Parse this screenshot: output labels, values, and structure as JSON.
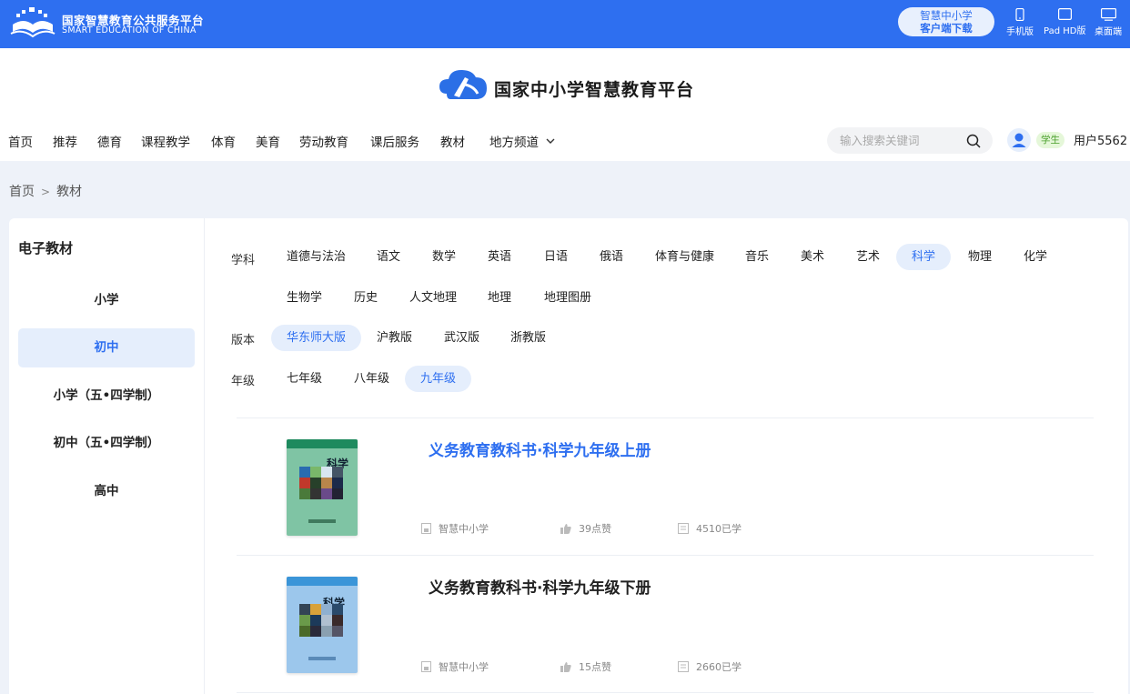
{
  "topbar": {
    "brand_cn": "国家智慧教育公共服务平台",
    "brand_en": "SMART EDUCATION OF CHINA",
    "download_line1": "智慧中小学",
    "download_line2": "客户端下载",
    "devices": [
      {
        "label": "手机版",
        "icon": "phone-icon"
      },
      {
        "label": "Pad HD版",
        "icon": "tablet-icon"
      },
      {
        "label": "桌面端",
        "icon": "desktop-icon"
      }
    ]
  },
  "header": {
    "site_title": "国家中小学智慧教育平台",
    "nav": [
      "首页",
      "推荐",
      "德育",
      "课程教学",
      "体育",
      "美育",
      "劳动教育",
      "课后服务",
      "教材",
      "地方频道"
    ],
    "search_placeholder": "输入搜索关键词",
    "role_badge": "学生",
    "username": "用户5562"
  },
  "breadcrumb": {
    "home": "首页",
    "sep": ">",
    "current": "教材"
  },
  "sidebar": {
    "title": "电子教材",
    "items": [
      "小学",
      "初中",
      "小学（五•四学制）",
      "初中（五•四学制）",
      "高中"
    ],
    "active": "初中"
  },
  "filters": {
    "subject_label": "学科",
    "subjects_row1": [
      "道德与法治",
      "语文",
      "数学",
      "英语",
      "日语",
      "俄语",
      "体育与健康",
      "音乐",
      "美术",
      "艺术",
      "科学",
      "物理",
      "化学"
    ],
    "subjects_row2": [
      "生物学",
      "历史",
      "人文地理",
      "地理",
      "地理图册"
    ],
    "subject_active": "科学",
    "edition_label": "版本",
    "editions": [
      "华东师大版",
      "沪教版",
      "武汉版",
      "浙教版"
    ],
    "edition_active": "华东师大版",
    "grade_label": "年级",
    "grades": [
      "七年级",
      "八年级",
      "九年级"
    ],
    "grade_active": "九年级"
  },
  "books": [
    {
      "title": "义务教育教科书·科学九年级上册",
      "cover_title": "科学",
      "publisher": "智慧中小学",
      "likes": "39点赞",
      "learners": "4510已学",
      "cover_color": "#7fc4a4",
      "cover_band": "#1e8a5e",
      "title_color": "#2e6ff0"
    },
    {
      "title": "义务教育教科书·科学九年级下册",
      "cover_title": "科学",
      "publisher": "智慧中小学",
      "likes": "15点赞",
      "learners": "2660已学",
      "cover_color": "#9cc7ec",
      "cover_band": "#3b95d8",
      "title_color": "#222222"
    }
  ],
  "colors": {
    "accent": "#2e6ff0",
    "accent_light": "#e5eefc",
    "topbar": "#2e6ff0"
  }
}
